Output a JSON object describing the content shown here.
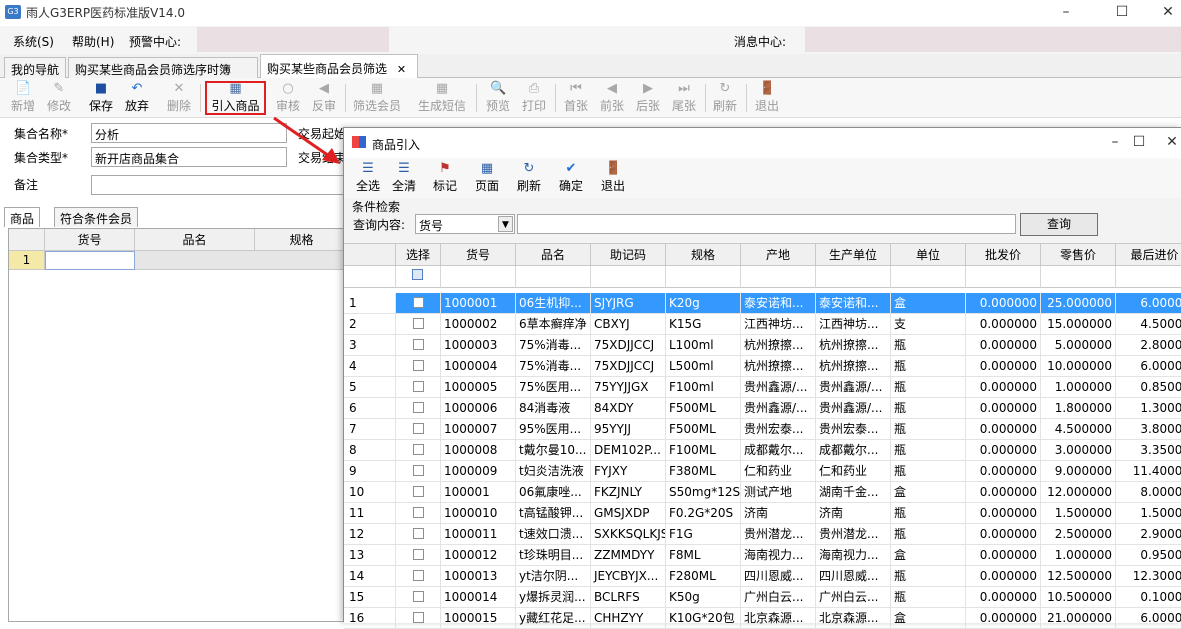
{
  "window": {
    "title": "雨人G3ERP医药标准版V14.0",
    "app_icon": "G3",
    "controls": [
      "minimize-icon",
      "maximize-icon",
      "close-icon"
    ]
  },
  "menu": {
    "items": [
      "系统(S)",
      "帮助(H)",
      "预警中心:"
    ],
    "message_center": "消息中心:"
  },
  "tabs": [
    {
      "label": "我的导航",
      "active": false
    },
    {
      "label": "购买某些商品会员筛选序时簿",
      "active": false
    },
    {
      "label": "购买某些商品会员筛选",
      "active": true,
      "close": "✕"
    }
  ],
  "toolbar": [
    {
      "label": "新增",
      "icon": "new-doc-icon",
      "enabled": false
    },
    {
      "label": "修改",
      "icon": "edit-icon",
      "enabled": false
    },
    {
      "label": "保存",
      "icon": "save-icon",
      "enabled": true
    },
    {
      "label": "放弃",
      "icon": "undo-icon",
      "enabled": true
    },
    {
      "label": "删除",
      "icon": "delete-icon",
      "enabled": false
    },
    {
      "label": "引入商品",
      "icon": "import-icon",
      "enabled": true,
      "highlighted": true
    },
    {
      "label": "审核",
      "icon": "approve-icon",
      "enabled": false
    },
    {
      "label": "反审",
      "icon": "unapprove-icon",
      "enabled": false
    },
    {
      "label": "筛选会员",
      "icon": "filter-member-icon",
      "enabled": false
    },
    {
      "label": "生成短信",
      "icon": "sms-icon",
      "enabled": false
    },
    {
      "label": "预览",
      "icon": "preview-icon",
      "enabled": false
    },
    {
      "label": "打印",
      "icon": "print-icon",
      "enabled": false
    },
    {
      "label": "首张",
      "icon": "first-icon",
      "enabled": false
    },
    {
      "label": "前张",
      "icon": "prev-icon",
      "enabled": false
    },
    {
      "label": "后张",
      "icon": "next-icon",
      "enabled": false
    },
    {
      "label": "尾张",
      "icon": "last-icon",
      "enabled": false
    },
    {
      "label": "刷新",
      "icon": "refresh-icon",
      "enabled": false
    },
    {
      "label": "退出",
      "icon": "exit-icon",
      "enabled": false
    }
  ],
  "form": {
    "set_name_label": "集合名称*",
    "set_name_value": "分析",
    "set_type_label": "集合类型*",
    "set_type_value": "新开店商品集合",
    "remark_label": "备注",
    "remark_value": "",
    "trade_start_label": "交易起始",
    "trade_end_label": "交易结束"
  },
  "left_tabs": [
    "商品",
    "符合条件会员"
  ],
  "left_grid": {
    "headers": [
      "货号",
      "品名",
      "规格"
    ],
    "rows": [
      {
        "no": "1",
        "code": "",
        "name": "",
        "spec": ""
      }
    ]
  },
  "dialog": {
    "title": "商品引入",
    "toolbar": [
      {
        "label": "全选",
        "icon": "select-all-icon"
      },
      {
        "label": "全清",
        "icon": "clear-all-icon"
      },
      {
        "label": "标记",
        "icon": "mark-icon"
      },
      {
        "label": "页面",
        "icon": "page-icon"
      },
      {
        "label": "刷新",
        "icon": "refresh-icon"
      },
      {
        "label": "确定",
        "icon": "confirm-icon"
      },
      {
        "label": "退出",
        "icon": "exit-icon"
      }
    ],
    "search_group": "条件检索",
    "query_label": "查询内容:",
    "query_field": "货号",
    "query_value": "",
    "query_button": "查询",
    "columns": [
      "选择",
      "货号",
      "品名",
      "助记码",
      "规格",
      "产地",
      "生产单位",
      "单位",
      "批发价",
      "零售价",
      "最后进价"
    ],
    "rows": [
      {
        "no": "1",
        "code": "1000001",
        "name": "06生机抑...",
        "mnemonic": "SJYJRG",
        "spec": "K20g",
        "origin": "泰安诺和...",
        "maker": "泰安诺和...",
        "unit": "盒",
        "wholesale": "0.000000",
        "retail": "25.000000",
        "last_cost": "6.00000",
        "selected": true
      },
      {
        "no": "2",
        "code": "1000002",
        "name": "6草本癣痒净",
        "mnemonic": "CBXYJ",
        "spec": "K15G",
        "origin": "江西神坊...",
        "maker": "江西神坊...",
        "unit": "支",
        "wholesale": "0.000000",
        "retail": "15.000000",
        "last_cost": "4.50000"
      },
      {
        "no": "3",
        "code": "1000003",
        "name": "75%消毒...",
        "mnemonic": "75XDJJCCJ",
        "spec": "L100ml",
        "origin": "杭州撩擦...",
        "maker": "杭州撩擦...",
        "unit": "瓶",
        "wholesale": "0.000000",
        "retail": "5.000000",
        "last_cost": "2.80000"
      },
      {
        "no": "4",
        "code": "1000004",
        "name": "75%消毒...",
        "mnemonic": "75XDJJCCJ",
        "spec": "L500ml",
        "origin": "杭州撩擦...",
        "maker": "杭州撩擦...",
        "unit": "瓶",
        "wholesale": "0.000000",
        "retail": "10.000000",
        "last_cost": "6.00000"
      },
      {
        "no": "5",
        "code": "1000005",
        "name": "75%医用...",
        "mnemonic": "75YYJJGX",
        "spec": "F100ml",
        "origin": "贵州鑫源/...",
        "maker": "贵州鑫源/...",
        "unit": "瓶",
        "wholesale": "0.000000",
        "retail": "1.000000",
        "last_cost": "0.85000"
      },
      {
        "no": "6",
        "code": "1000006",
        "name": "84消毒液",
        "mnemonic": "84XDY",
        "spec": "F500ML",
        "origin": "贵州鑫源/...",
        "maker": "贵州鑫源/...",
        "unit": "瓶",
        "wholesale": "0.000000",
        "retail": "1.800000",
        "last_cost": "1.30000"
      },
      {
        "no": "7",
        "code": "1000007",
        "name": "95%医用...",
        "mnemonic": "95YYJJ",
        "spec": "F500ML",
        "origin": "贵州宏泰...",
        "maker": "贵州宏泰...",
        "unit": "瓶",
        "wholesale": "0.000000",
        "retail": "4.500000",
        "last_cost": "3.80000"
      },
      {
        "no": "8",
        "code": "1000008",
        "name": "t戴尔曼10...",
        "mnemonic": "DEM102P...",
        "spec": "F100ML",
        "origin": "成都戴尔...",
        "maker": "成都戴尔...",
        "unit": "瓶",
        "wholesale": "0.000000",
        "retail": "3.000000",
        "last_cost": "3.35000"
      },
      {
        "no": "9",
        "code": "1000009",
        "name": "t妇炎洁洗液",
        "mnemonic": "FYJXY",
        "spec": "F380ML",
        "origin": "仁和药业",
        "maker": "仁和药业",
        "unit": "瓶",
        "wholesale": "0.000000",
        "retail": "9.000000",
        "last_cost": "11.40000"
      },
      {
        "no": "10",
        "code": "100001",
        "name": "06氟康唑...",
        "mnemonic": "FKZJNLY",
        "spec": "S50mg*12S",
        "origin": "测试产地",
        "maker": "湖南千金...",
        "unit": "盒",
        "wholesale": "0.000000",
        "retail": "12.000000",
        "last_cost": "8.00000"
      },
      {
        "no": "11",
        "code": "1000010",
        "name": "t高锰酸钾...",
        "mnemonic": "GMSJXDP",
        "spec": "F0.2G*20S",
        "origin": "济南",
        "maker": "济南",
        "unit": "瓶",
        "wholesale": "0.000000",
        "retail": "1.500000",
        "last_cost": "1.50000"
      },
      {
        "no": "12",
        "code": "1000011",
        "name": "t速效口溃...",
        "mnemonic": "SXKKSQLKJS",
        "spec": "F1G",
        "origin": "贵州潜龙...",
        "maker": "贵州潜龙...",
        "unit": "瓶",
        "wholesale": "0.000000",
        "retail": "2.500000",
        "last_cost": "2.90000"
      },
      {
        "no": "13",
        "code": "1000012",
        "name": "t珍珠明目...",
        "mnemonic": "ZZMMDYY",
        "spec": "F8ML",
        "origin": "海南视力...",
        "maker": "海南视力...",
        "unit": "盒",
        "wholesale": "0.000000",
        "retail": "1.000000",
        "last_cost": "0.95000"
      },
      {
        "no": "14",
        "code": "1000013",
        "name": "yt洁尔阴...",
        "mnemonic": "JEYCBYJX...",
        "spec": "F280ML",
        "origin": "四川恩威...",
        "maker": "四川恩威...",
        "unit": "瓶",
        "wholesale": "0.000000",
        "retail": "12.500000",
        "last_cost": "12.30000"
      },
      {
        "no": "15",
        "code": "1000014",
        "name": "y爆拆灵润...",
        "mnemonic": "BCLRFS",
        "spec": "K50g",
        "origin": "广州白云...",
        "maker": "广州白云...",
        "unit": "瓶",
        "wholesale": "0.000000",
        "retail": "10.500000",
        "last_cost": "0.10000"
      },
      {
        "no": "16",
        "code": "1000015",
        "name": "y藏红花足...",
        "mnemonic": "CHHZYY",
        "spec": "K10G*20包",
        "origin": "北京森源...",
        "maker": "北京森源...",
        "unit": "盒",
        "wholesale": "0.000000",
        "retail": "21.000000",
        "last_cost": "6.00000"
      }
    ]
  },
  "colors": {
    "selection": "#3399ff",
    "highlight_box": "#e02020",
    "arrow": "#e02020",
    "toolbar_bg": "#f7f7f7"
  }
}
